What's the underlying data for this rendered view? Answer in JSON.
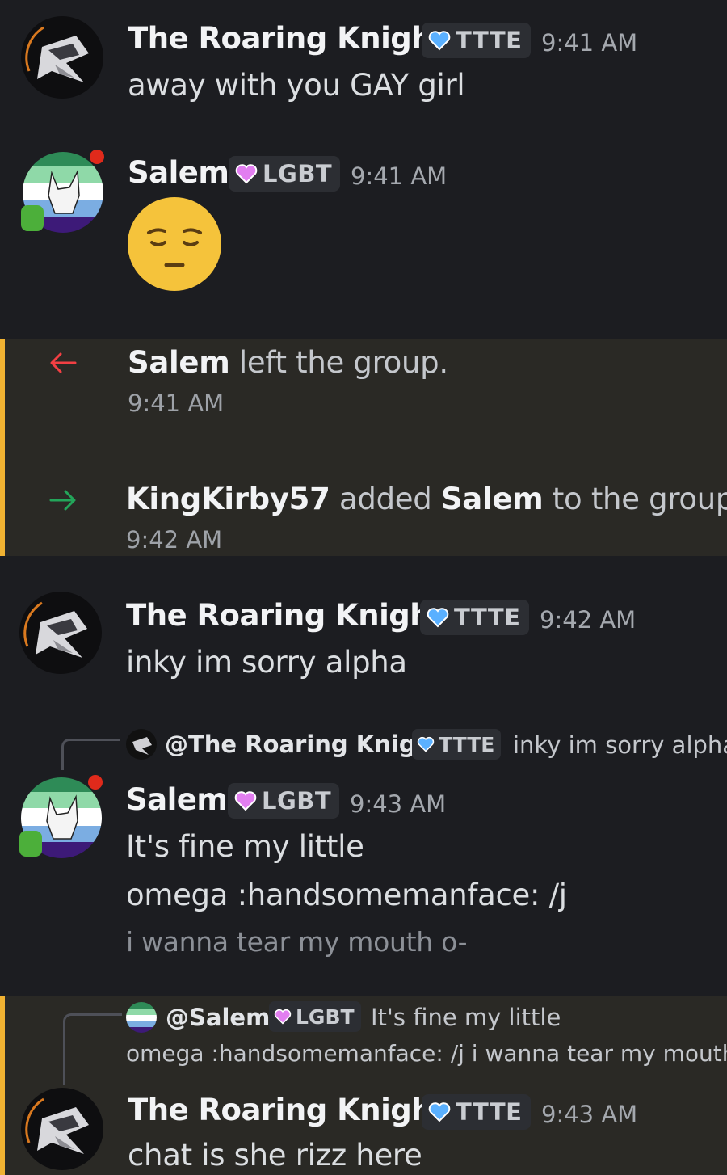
{
  "colors": {
    "background": "#1c1d21",
    "system_band": "#2a2925",
    "system_accent": "#f0b232",
    "ttte_heart": "#5ab0ff",
    "lgbt_heart": "#e27ef0",
    "leave_arrow": "#f23f43",
    "join_arrow": "#23a55a"
  },
  "messages": [
    {
      "author": "The Roaring Knight",
      "tag": "TTTE",
      "time": "9:41 AM",
      "text": "away with you GAY girl"
    },
    {
      "author": "Salem",
      "tag": "LGBT",
      "time": "9:41 AM",
      "emoji": "pensive-face"
    },
    {
      "author": "The Roaring Knight",
      "tag": "TTTE",
      "time": "9:42 AM",
      "text": "inky im sorry alpha"
    },
    {
      "author": "Salem",
      "tag": "LGBT",
      "time": "9:43 AM",
      "text_line1": "It's fine my little",
      "text_line2": "omega :handsomemanface: /j",
      "text_line3": "i wanna tear my mouth o-",
      "reply": {
        "author": "@The Roaring Knight",
        "tag": "TTTE",
        "text": "inky im sorry alpha"
      }
    },
    {
      "author": "The Roaring Knight",
      "tag": "TTTE",
      "time": "9:43 AM",
      "text": "chat is she rizz here",
      "reply": {
        "author": "@Salem",
        "tag": "LGBT",
        "text_line1": "It's fine my little",
        "text_line2": "omega :handsomemanface: /j i wanna tear my mouth"
      }
    }
  ],
  "system": [
    {
      "icon": "leave-arrow-icon",
      "actor": "Salem",
      "action": "left the group.",
      "time": "9:41 AM"
    },
    {
      "icon": "join-arrow-icon",
      "actor": "KingKirby57",
      "action": "added",
      "target": "Salem",
      "suffix": "to the group.",
      "time": "9:42 AM"
    }
  ]
}
